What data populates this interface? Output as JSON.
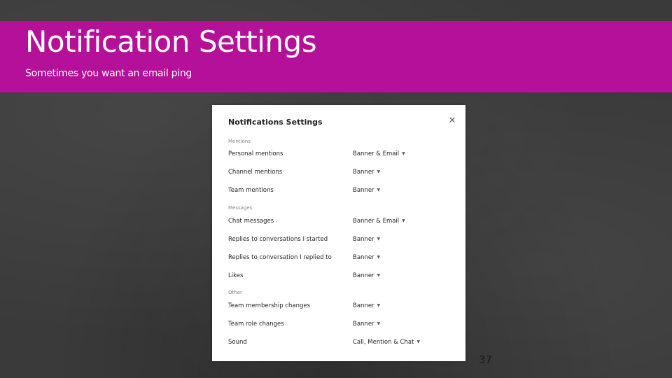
{
  "slide": {
    "title": "Notification Settings",
    "subtitle": "Sometimes you want an email ping",
    "page_number": "37"
  },
  "dialog": {
    "title": "Notifications Settings",
    "close_icon": "close-icon",
    "sections": [
      {
        "label": "Mentions",
        "rows": [
          {
            "label": "Personal mentions",
            "value": "Banner & Email"
          },
          {
            "label": "Channel mentions",
            "value": "Banner"
          },
          {
            "label": "Team mentions",
            "value": "Banner"
          }
        ]
      },
      {
        "label": "Messages",
        "rows": [
          {
            "label": "Chat messages",
            "value": "Banner & Email"
          },
          {
            "label": "Replies to conversations I started",
            "value": "Banner"
          },
          {
            "label": "Replies to conversation I replied to",
            "value": "Banner"
          },
          {
            "label": "Likes",
            "value": "Banner"
          }
        ]
      },
      {
        "label": "Other",
        "rows": [
          {
            "label": "Team membership changes",
            "value": "Banner"
          },
          {
            "label": "Team role changes",
            "value": "Banner"
          },
          {
            "label": "Sound",
            "value": "Call, Mention & Chat"
          }
        ]
      }
    ]
  },
  "colors": {
    "banner": "#b4109a",
    "background": "#3a3a3a",
    "dialog": "#ffffff"
  }
}
